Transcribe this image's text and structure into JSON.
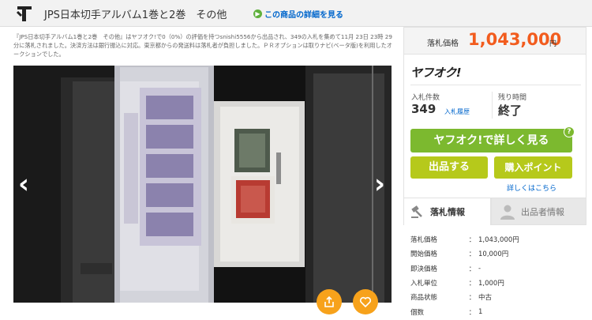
{
  "header": {
    "title": "JPS日本切手アルバム1巻と2巻　その他",
    "detail_link": "この商品の詳細を見る"
  },
  "description": "『JPS日本切手アルバム1巻と2巻　その他』はヤフオク!で0（0%）の評価を持つsnishi5556から出品され、349の入札を集めて11月 23日 23時 29分に落札されました。決済方法は銀行振込に対応。東京都からの発送料は落札者が負担しました。ＰＲオプションは取りナビ(ベータ版)を利用したオークションでした。",
  "price": {
    "label": "落札価格",
    "value": "1,043,000",
    "unit": "円"
  },
  "auction": {
    "logo": "ヤフオク!",
    "bids_label": "入札件数",
    "bids_count": "349",
    "bid_history": "入札履歴",
    "remaining_label": "残り時間",
    "remaining_value": "終了",
    "detail_button": "ヤフオク!で詳しく見る",
    "help_badge": "?",
    "sell_button": "出品する",
    "point_button": "購入ポイント",
    "point_more": "詳しくはこちら"
  },
  "tabs": [
    {
      "label": "落札情報",
      "icon": "gavel-icon",
      "active": true
    },
    {
      "label": "出品者情報",
      "icon": "user-icon",
      "active": false
    }
  ],
  "info": [
    {
      "key": "落札価格",
      "value": "1,043,000円"
    },
    {
      "key": "開始価格",
      "value": "10,000円"
    },
    {
      "key": "即決価格",
      "value": "-"
    },
    {
      "key": "入札単位",
      "value": "1,000円"
    },
    {
      "key": "商品状態",
      "value": "中古"
    },
    {
      "key": "個数",
      "value": "1"
    }
  ],
  "info_separator": "：",
  "colors": {
    "accent_orange": "#f25c1e",
    "green_button": "#7cb92f",
    "olive_button": "#b6c91b",
    "link_blue": "#0066cc",
    "round_button": "#f7a21b"
  }
}
